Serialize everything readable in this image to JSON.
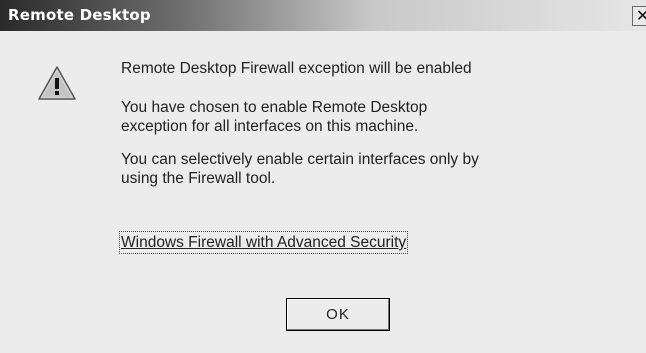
{
  "window": {
    "title": "Remote Desktop",
    "close_glyph": "✕"
  },
  "message": {
    "heading": "Remote Desktop Firewall exception will be enabled",
    "paragraph1_line1": "You have chosen to enable Remote Desktop",
    "paragraph1_line2": "exception for all interfaces on this machine.",
    "paragraph2_line1": "You can selectively enable certain interfaces only by",
    "paragraph2_line2": "using the Firewall tool."
  },
  "link": {
    "label": "Windows Firewall with Advanced Security"
  },
  "buttons": {
    "ok_label": "OK"
  },
  "icons": {
    "warning": "warning-icon",
    "close": "close-icon"
  }
}
